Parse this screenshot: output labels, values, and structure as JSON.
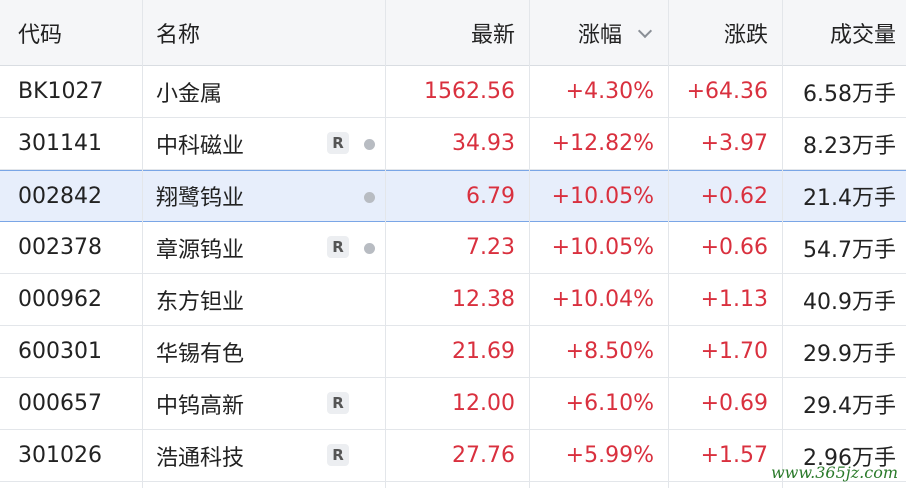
{
  "header": {
    "code": "代码",
    "name": "名称",
    "last": "最新",
    "pct": "涨幅",
    "chg": "涨跌",
    "vol": "成交量"
  },
  "rows": [
    {
      "code": "BK1027",
      "name": "小金属",
      "last": "1562.56",
      "pct": "+4.30%",
      "chg": "+64.36",
      "vol": "6.58万手",
      "badge": "",
      "dot": false,
      "selected": false
    },
    {
      "code": "301141",
      "name": "中科磁业",
      "last": "34.93",
      "pct": "+12.82%",
      "chg": "+3.97",
      "vol": "8.23万手",
      "badge": "R",
      "dot": true,
      "selected": false
    },
    {
      "code": "002842",
      "name": "翔鹭钨业",
      "last": "6.79",
      "pct": "+10.05%",
      "chg": "+0.62",
      "vol": "21.4万手",
      "badge": "",
      "dot": true,
      "selected": true
    },
    {
      "code": "002378",
      "name": "章源钨业",
      "last": "7.23",
      "pct": "+10.05%",
      "chg": "+0.66",
      "vol": "54.7万手",
      "badge": "R",
      "dot": true,
      "selected": false
    },
    {
      "code": "000962",
      "name": "东方钽业",
      "last": "12.38",
      "pct": "+10.04%",
      "chg": "+1.13",
      "vol": "40.9万手",
      "badge": "",
      "dot": false,
      "selected": false
    },
    {
      "code": "600301",
      "name": "华锡有色",
      "last": "21.69",
      "pct": "+8.50%",
      "chg": "+1.70",
      "vol": "29.9万手",
      "badge": "",
      "dot": false,
      "selected": false
    },
    {
      "code": "000657",
      "name": "中钨高新",
      "last": "12.00",
      "pct": "+6.10%",
      "chg": "+0.69",
      "vol": "29.4万手",
      "badge": "R",
      "dot": false,
      "selected": false
    },
    {
      "code": "301026",
      "name": "浩通科技",
      "last": "27.76",
      "pct": "+5.99%",
      "chg": "+1.57",
      "vol": "2.96万手",
      "badge": "R",
      "dot": false,
      "selected": false
    }
  ],
  "colors": {
    "up": "#d9303e",
    "selected_bg": "#e7eefb"
  },
  "watermark": "www.365jz.com"
}
